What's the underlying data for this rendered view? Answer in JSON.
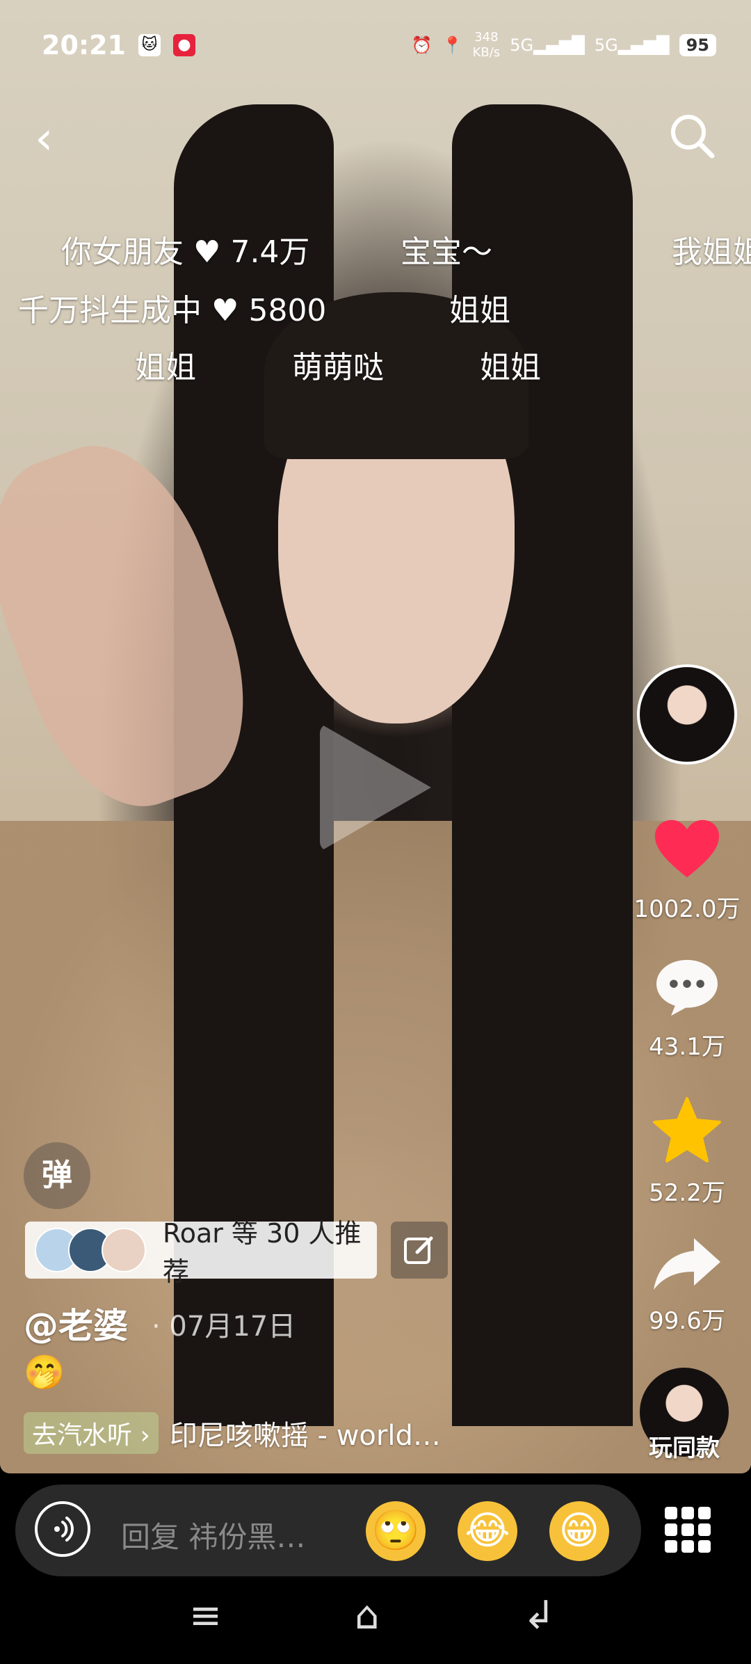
{
  "status_bar": {
    "time": "20:21",
    "net_speed_top": "348",
    "net_speed_bottom": "KB/s",
    "signal1": "5G",
    "signal2": "5G",
    "battery": "95"
  },
  "danmaku": [
    {
      "text": "你女朋友",
      "heart_count": "7.4万"
    },
    {
      "text": "宝宝～"
    },
    {
      "text": "我姐姐"
    },
    {
      "text": "千万抖生成中",
      "heart_count": "5800"
    },
    {
      "text": "姐姐"
    },
    {
      "text": "姐姐"
    },
    {
      "text": "萌萌哒"
    },
    {
      "text": "姐姐"
    }
  ],
  "actions": {
    "likes": "1002.0万",
    "comments": "43.1万",
    "favorites": "52.2万",
    "shares": "99.6万",
    "same_style": "玩同款"
  },
  "danmaku_toggle": "弹",
  "recommend": {
    "label": "Roar 等 30 人推荐"
  },
  "post": {
    "author": "@老婆",
    "date": "· 07月17日",
    "caption_emoji": "🤭"
  },
  "music": {
    "tag": "去汽水听 ›",
    "title": "印尼咳嗽摇 - world…"
  },
  "comment_bar": {
    "placeholder": "回复 祎份黑…",
    "emojis": [
      "🙄",
      "😂",
      "😁"
    ]
  },
  "colors": {
    "like": "#fe2c55",
    "favorite": "#ffc300"
  }
}
